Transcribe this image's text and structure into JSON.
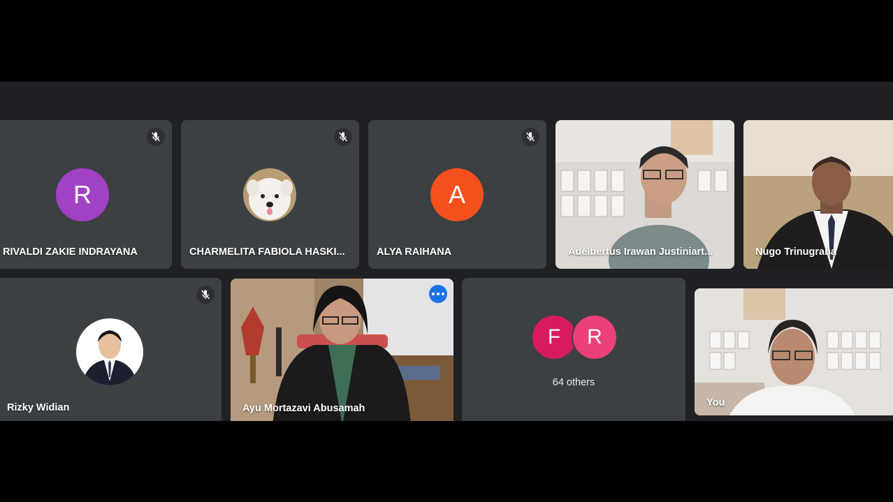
{
  "participants": [
    {
      "name": "RIVALDI ZAKIE INDRAYANA",
      "initial": "R",
      "avatar_color": "#a142c4",
      "muted": true
    },
    {
      "name": "CHARMELITA FABIOLA HASKI...",
      "muted": true
    },
    {
      "name": "ALYA RAIHANA",
      "initial": "A",
      "avatar_color": "#f4511e",
      "muted": true
    },
    {
      "name": "Adelbertus Irawan Justiniart...",
      "muted": false
    },
    {
      "name": "Nugo Trinugraha",
      "muted": false
    },
    {
      "name": "Rizky Widian",
      "muted": true
    },
    {
      "name": "Ayu Mortazavi Abusamah",
      "muted": false,
      "active": true
    },
    {
      "name": "You",
      "muted": false
    }
  ],
  "others": {
    "label": "64 others",
    "avatars": [
      {
        "initial": "F",
        "color": "#d81b60"
      },
      {
        "initial": "R",
        "color": "#ec407a"
      }
    ]
  },
  "icons": {
    "muted": "mic-off-icon",
    "more": "more-options-icon"
  },
  "colors": {
    "tile_bg": "#3c4043",
    "stage_bg": "#202124",
    "active_border": "#8ab4f8"
  }
}
